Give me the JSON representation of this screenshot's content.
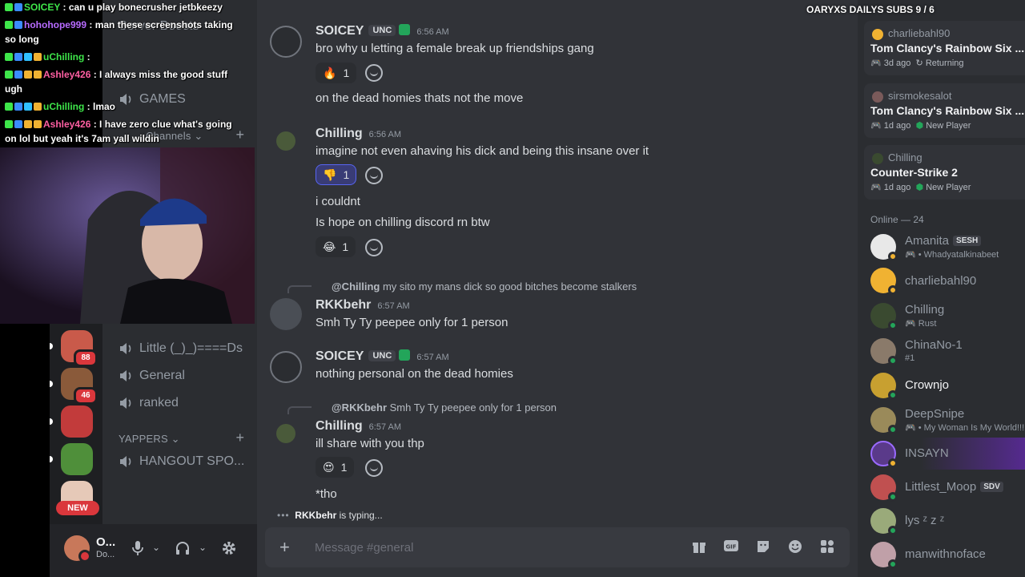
{
  "overlay": {
    "title": "OARYXS DAILYS SUBS 9 / 6",
    "stream_chat": [
      {
        "user": "SOICEY",
        "user_color": "#3ee64a",
        "text": ": can u play bonecrusher jetbkeezy",
        "cont": ""
      },
      {
        "user": "hohohope999",
        "user_color": "#b76bff",
        "text": ": man these screenshots taking",
        "cont": "so long"
      },
      {
        "user": "uChilling",
        "user_color": "#3ee64a",
        "text": ":",
        "cont": ""
      },
      {
        "user": "Ashley426",
        "user_color": "#ff5fa2",
        "text": ": I always miss the good stuff",
        "cont": "ugh"
      },
      {
        "user": "uChilling",
        "user_color": "#3ee64a",
        "text": ": lmao",
        "cont": ""
      },
      {
        "user": "Ashley426",
        "user_color": "#ff5fa2",
        "text": ": I have zero clue what's going",
        "cont": "on lol but yeah it's 7am yall wildin"
      }
    ]
  },
  "servers": [
    {
      "badge": "88",
      "color": "#c95a4a"
    },
    {
      "badge": "46",
      "color": "#8a5a3a"
    },
    {
      "badge": "",
      "color": "#c23b3b"
    },
    {
      "badge": "",
      "color": "#4f8f3a"
    },
    {
      "badge": "",
      "color": "#e6c9b8"
    }
  ],
  "new_label": "NEW",
  "sidebar": {
    "channels_top": [
      "Server Boosts",
      "GAMES"
    ],
    "channels_category": "Channels",
    "channels_mid": [
      "Little (_)_)====Ds",
      "General",
      "ranked"
    ],
    "yappers_category": "YAPPERS",
    "yappers_channels": [
      "HANGOUT SPO..."
    ]
  },
  "user_panel": {
    "name": "O...",
    "status": "Do..."
  },
  "messages": [
    {
      "author": "SOICEY",
      "color": "#f2f3f5",
      "tag": "UNC",
      "time": "6:56 AM",
      "text": "bro why u letting a female break up friendships gang",
      "reaction": {
        "emoji": "🔥",
        "count": "1"
      }
    },
    {
      "text": "on the dead homies thats not the move"
    },
    {
      "author": "Chilling",
      "color": "#f2f3f5",
      "time": "6:56 AM",
      "text": "imagine not even ahaving his dick and being this insane over it",
      "reaction": {
        "emoji": "👎",
        "count": "1"
      }
    },
    {
      "text": "i couldnt"
    },
    {
      "text": "Is hope on chilling discord rn btw",
      "reaction": {
        "emoji": "😂",
        "count": "1"
      }
    },
    {
      "reply_user": "@Chilling",
      "reply_text": "my sito my mans dick so good bitches become stalkers",
      "author": "RKKbehr",
      "color": "#f2f3f5",
      "time": "6:57 AM",
      "text": "Smh Ty Ty peepee only for 1 person"
    },
    {
      "author": "SOICEY",
      "color": "#f2f3f5",
      "tag": "UNC",
      "time": "6:57 AM",
      "text": "nothing personal on the dead homies"
    },
    {
      "reply_user": "@RKKbehr",
      "reply_text": "Smh Ty Ty peepee only for 1 person",
      "author": "Chilling",
      "color": "#f2f3f5",
      "time": "6:57 AM",
      "text": "ill share with you thp",
      "reaction": {
        "emoji": "😍",
        "count": "1"
      }
    },
    {
      "text": "*tho"
    }
  ],
  "typing": {
    "user": "RKKbehr",
    "suffix": "is typing..."
  },
  "composer": {
    "placeholder": "Message #general"
  },
  "activity_cards": [
    {
      "user": "charliebahl90",
      "game": "Tom Clancy's Rainbow Six ...",
      "meta": "3d ago",
      "status": "Returning"
    },
    {
      "user": "sirsmokesalot",
      "game": "Tom Clancy's Rainbow Six ...",
      "meta": "1d ago",
      "status": "New Player"
    },
    {
      "user": "Chilling",
      "game": "Counter-Strike 2",
      "meta": "1d ago",
      "status": "New Player"
    }
  ],
  "online_header": "Online — 24",
  "members": [
    {
      "name": "Amanita",
      "tag": "SESH",
      "sub": "Whadyatalkinabeet",
      "color": "#e8e8e8",
      "status": "#f0b232"
    },
    {
      "name": "charliebahl90",
      "tag": "",
      "sub": "",
      "color": "#f0b232",
      "status": "#f0b232"
    },
    {
      "name": "Chilling",
      "tag": "",
      "sub": "Rust",
      "color": "#3a4a30",
      "status": "#23a55a"
    },
    {
      "name": "ChinaNo-1",
      "tag": "",
      "sub": "#1",
      "color": "#8a7a6a",
      "status": "#23a55a"
    },
    {
      "name": "Crownjo",
      "tag": "",
      "sub": "",
      "color": "#c8a030",
      "status": "#23a55a"
    },
    {
      "name": "DeepSnipe",
      "tag": "",
      "sub": "My Woman Is My World!!!",
      "color": "#9a8a5a",
      "status": "#23a55a"
    },
    {
      "name": "INSAYN",
      "tag": "",
      "sub": "",
      "color": "#5a3a8a",
      "status": "#f0b232"
    },
    {
      "name": "Littlest_Moop",
      "tag": "SDV",
      "sub": "",
      "color": "#c05050",
      "status": "#23a55a"
    },
    {
      "name": "lys ᶻ z ᶻ",
      "tag": "",
      "sub": "",
      "color": "#9aaa7a",
      "status": "#23a55a"
    },
    {
      "name": "manwithnoface",
      "tag": "",
      "sub": "",
      "color": "#c0a0a8",
      "status": "#23a55a"
    }
  ]
}
